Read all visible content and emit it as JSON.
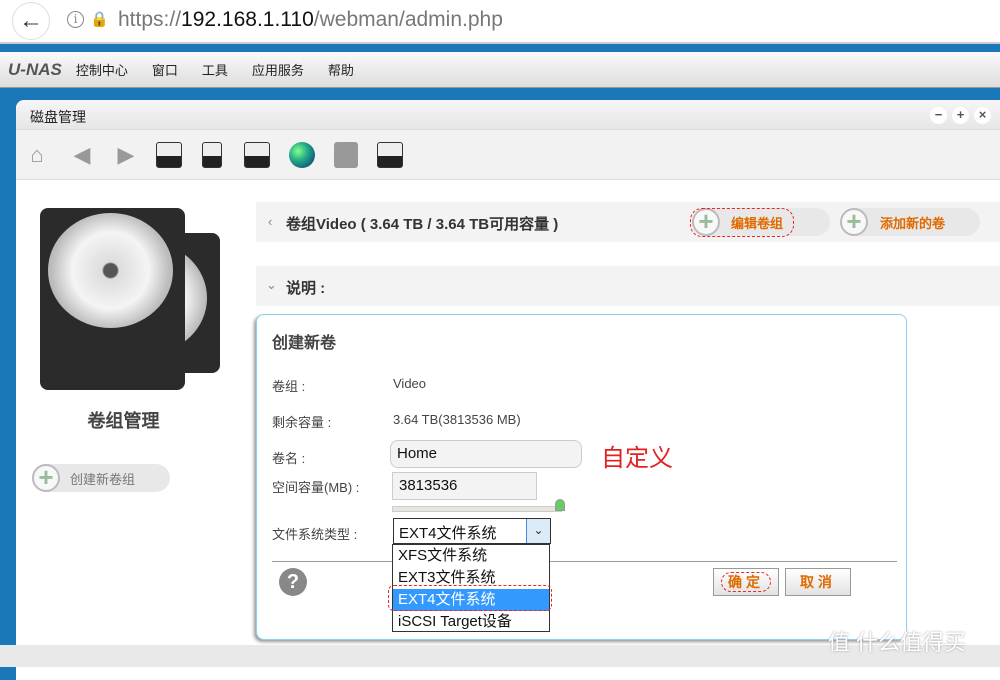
{
  "browser": {
    "url_prefix": "https://",
    "url_host": "192.168.1.110",
    "url_path": "/webman/admin.php"
  },
  "menubar": {
    "logo": "U-NAS",
    "items": [
      "控制中心",
      "窗口",
      "工具",
      "应用服务",
      "帮助"
    ]
  },
  "window": {
    "title": "磁盘管理",
    "controls": [
      "minimize",
      "maximize",
      "close"
    ]
  },
  "toolbar": {
    "icons": [
      "home-icon",
      "back-icon",
      "forward-icon",
      "disk-icon",
      "disk-stack-icon",
      "multi-disk-icon",
      "network-globe-icon",
      "disk-check-icon",
      "disk-list-icon"
    ]
  },
  "sidebar": {
    "title": "卷组管理",
    "create_button": "创建新卷组"
  },
  "volume_group": {
    "title": "卷组Video ( 3.64 TB / 3.64 TB可用容量 )",
    "edit_button": "编辑卷组",
    "add_volume_button": "添加新的卷"
  },
  "description": {
    "label": "说明 :"
  },
  "dialog": {
    "title": "创建新卷",
    "group_label": "卷组 :",
    "group_value": "Video",
    "free_label": "剩余容量 :",
    "free_value": "3.64 TB(3813536 MB)",
    "name_label": "卷名 :",
    "name_value": "Home",
    "size_label": "空间容量(MB) :",
    "size_value": "3813536",
    "size_slider_percent": 100,
    "fs_label": "文件系统类型 :",
    "fs_value": "EXT4文件系统",
    "fs_options": [
      "XFS文件系统",
      "EXT3文件系统",
      "EXT4文件系统",
      "iSCSI Target设备"
    ],
    "fs_selected_index": 2,
    "ok_button": "确定",
    "cancel_button": "取消"
  },
  "annotation": {
    "text": "自定义",
    "color": "#e22222"
  },
  "watermark": {
    "text": "值 什么值得买"
  },
  "colors": {
    "accent_orange": "#e06a00",
    "desktop_blue": "#1a78b8",
    "selection_blue": "#3399ff"
  }
}
